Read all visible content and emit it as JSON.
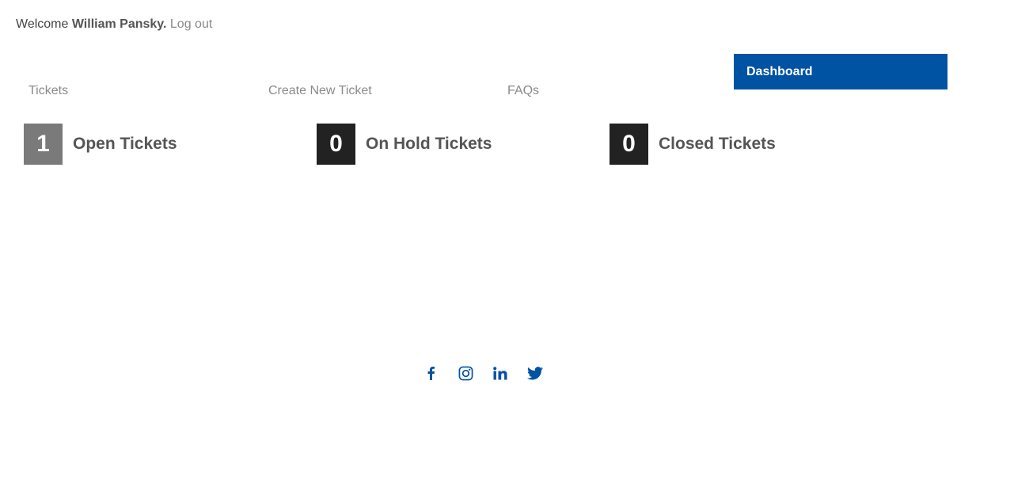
{
  "header": {
    "welcome_prefix": "Welcome",
    "user_name": "William Pansky.",
    "logout_label": "Log out"
  },
  "nav": {
    "tickets": "Tickets",
    "create_new_ticket": "Create New Ticket",
    "faqs": "FAQs",
    "dashboard": "Dashboard"
  },
  "stats": {
    "open": {
      "count": "1",
      "label": "Open Tickets"
    },
    "on_hold": {
      "count": "0",
      "label": "On Hold Tickets"
    },
    "closed": {
      "count": "0",
      "label": "Closed Tickets"
    }
  },
  "social": [
    "facebook-icon",
    "instagram-icon",
    "linkedin-icon",
    "twitter-icon"
  ],
  "colors": {
    "accent": "#0052a3",
    "open_count_bg": "#7a7a7a",
    "dark_count_bg": "#222222"
  }
}
